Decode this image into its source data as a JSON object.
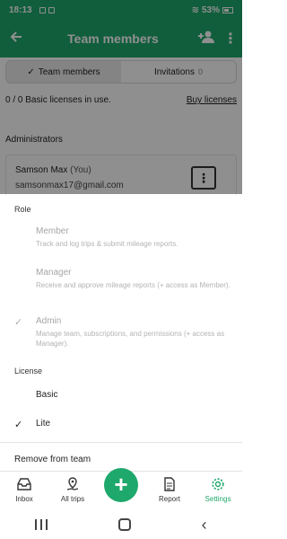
{
  "status_bar": {
    "time": "18:13",
    "battery": "53%"
  },
  "app_bar": {
    "title": "Team members"
  },
  "tabs": [
    {
      "label": "Team members",
      "count": ""
    },
    {
      "label": "Invitations",
      "count": "0"
    }
  ],
  "licenses": {
    "usage_text": "0 / 0 Basic licenses in use.",
    "buy_label": "Buy licenses"
  },
  "administrators": {
    "label": "Administrators",
    "member": {
      "name": "Samson Max",
      "you_tag": "(You)",
      "email": "samsonmax17@gmail.com"
    }
  },
  "sheet": {
    "role_label": "Role",
    "roles": [
      {
        "title": "Member",
        "description": "Track and log trips & submit mileage reports.",
        "checked": false
      },
      {
        "title": "Manager",
        "description": "Receive and approve mileage reports (+ access as Member).",
        "checked": false
      },
      {
        "title": "Admin",
        "description": "Manage team, subscriptions, and permissions (+ access as Manager).",
        "checked": true
      }
    ],
    "license_label": "License",
    "licenses": [
      {
        "title": "Basic",
        "checked": false
      },
      {
        "title": "Lite",
        "checked": true
      }
    ],
    "remove_label": "Remove from team"
  },
  "bottom_nav": [
    {
      "label": "Inbox",
      "icon": "inbox-icon"
    },
    {
      "label": "All trips",
      "icon": "map-pin-icon"
    },
    {
      "label": "Report",
      "icon": "report-icon"
    },
    {
      "label": "Settings",
      "icon": "gear-icon"
    }
  ],
  "colors": {
    "brand": "#1fa86c"
  }
}
